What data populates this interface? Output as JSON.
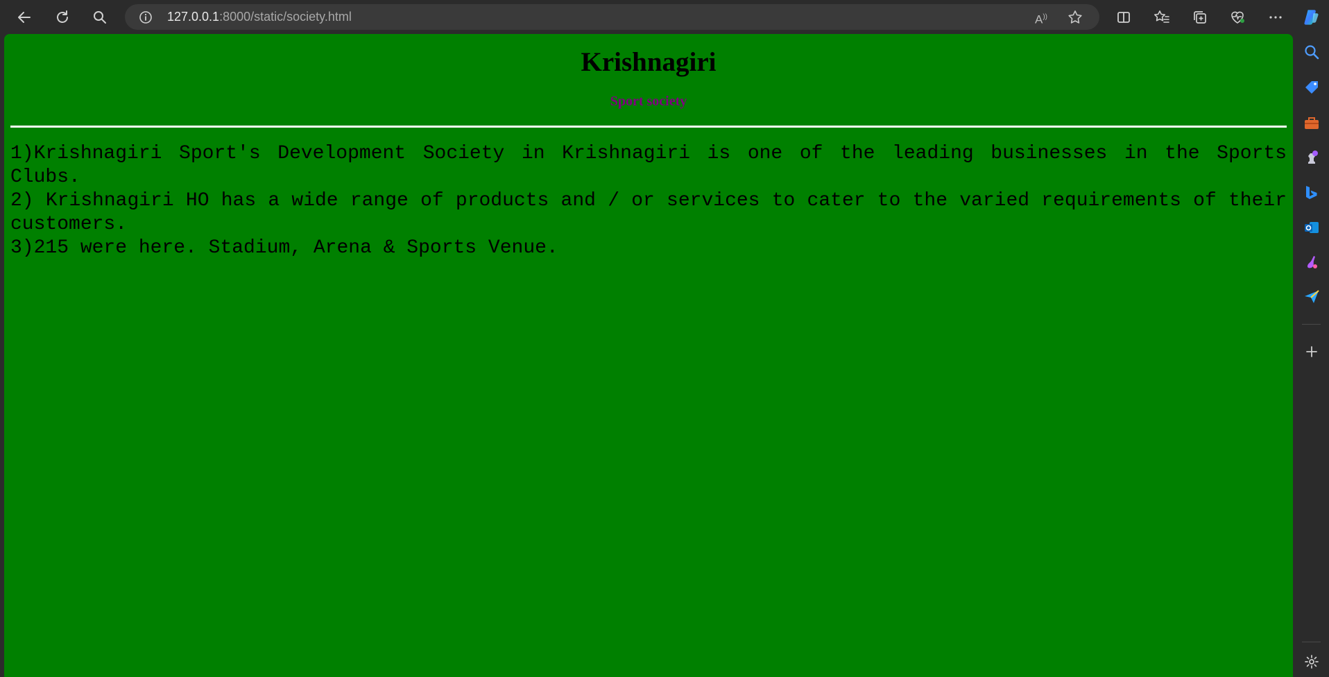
{
  "browser": {
    "url_host": "127.0.0.1",
    "url_rest": ":8000/static/society.html",
    "read_aloud_label": "A",
    "icons": {
      "back": "back-arrow-icon",
      "refresh": "refresh-icon",
      "search": "search-icon",
      "site_info": "info-icon",
      "read_aloud": "read-aloud-icon",
      "favorite": "star-icon",
      "split_screen": "split-screen-icon",
      "favorites": "favorites-list-icon",
      "collections": "collections-icon",
      "browser_essentials": "heart-pulse-icon",
      "more": "more-dots-icon",
      "copilot": "copilot-icon"
    }
  },
  "sidebar": {
    "items": [
      "search-icon",
      "shopping-tag-icon",
      "toolbox-icon",
      "chess-icon",
      "bing-icon",
      "outlook-icon",
      "drop-icon",
      "send-icon",
      "add-icon",
      "settings-icon"
    ]
  },
  "page": {
    "title": "Krishnagiri",
    "subtitle": "Sport society",
    "paragraphs": [
      "1)Krishnagiri Sport's Development Society in Krishnagiri is one of the leading businesses in the Sports Clubs.",
      "2) Krishnagiri HO has a wide range of products and / or services to cater to the varied requirements of their customers.",
      "3)215 were here. Stadium, Arena & Sports Venue."
    ],
    "colors": {
      "background": "#008000",
      "title": "#000000",
      "subtitle": "#800080",
      "rule": "#ffffff",
      "text": "#000000"
    }
  }
}
